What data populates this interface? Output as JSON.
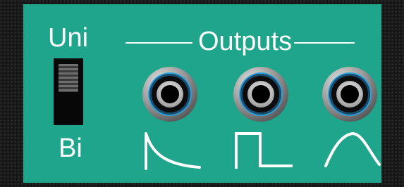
{
  "panel": {
    "color": "#1fa58b",
    "switch": {
      "top_label": "Uni",
      "bottom_label": "Bi"
    },
    "outputs": {
      "title": "Outputs",
      "jacks": [
        {
          "shape": "decay-envelope-icon"
        },
        {
          "shape": "square-gate-icon"
        },
        {
          "shape": "attack-release-envelope-icon"
        }
      ]
    }
  }
}
